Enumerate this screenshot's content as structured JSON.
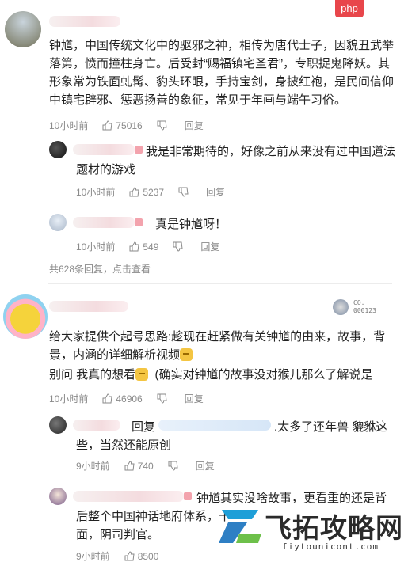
{
  "badge": "php",
  "comment1": {
    "text": "钟馗，中国传统文化中的驱邪之神，相传为唐代士子，因貌丑武举落第，愤而撞柱身亡。后受封“赐福镇宅圣君”，专职捉鬼降妖。其形象常为铁面虬髯、豹头环眼，手持宝剑，身披红袍，是民间信仰中镇宅辟邪、惩恶扬善的象征，常见于年画与端午习俗。",
    "time": "10小时前",
    "likes": "75016",
    "reply": "回复",
    "replies": [
      {
        "text": "我是非常期待的，好像之前从来没有过中国道法题材的游戏",
        "time": "10小时前",
        "likes": "5237",
        "reply": "回复"
      },
      {
        "text": "真是钟馗呀！",
        "time": "10小时前",
        "likes": "549",
        "reply": "回复"
      }
    ],
    "more_replies": "共628条回复，点击查看"
  },
  "comment2": {
    "badge": "CO. 000123",
    "line1": "给大家提供个起号思路:趁现在赶紧做有关钟馗的由来，故事，背景，内涵的详细解析视频",
    "line2a": "别问 我真的想看",
    "line2b": "(确实对钟馗的故事没对猴儿那么了解说是",
    "time": "10小时前",
    "likes": "46906",
    "reply": "回复",
    "replies": [
      {
        "prefix": "回复",
        "text": ".太多了还年兽 貔貅这些，当然还能原创",
        "time": "9小时前",
        "likes": "740",
        "reply": "回复"
      },
      {
        "text": "钟馗其实没啥故事，更看重的还是背后整个中国神话地府体系，十",
        "text_tail": "面，阴司判官。",
        "time": "9小时前",
        "likes": "8500"
      }
    ]
  },
  "watermark": {
    "name": "飞拓攻略网",
    "url": "fiytounicont.com"
  }
}
